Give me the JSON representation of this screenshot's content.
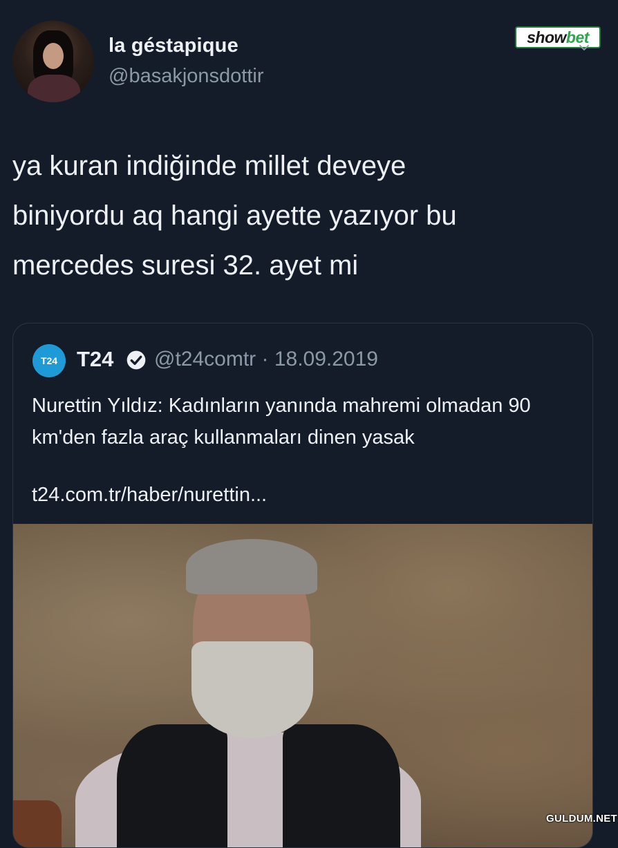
{
  "author": {
    "display_name": "la géstapique",
    "handle": "@basakjonsdottir"
  },
  "badge": {
    "part1": "show",
    "part2": "bet"
  },
  "tweet": {
    "text_line1": "ya kuran indiğinde millet deveye",
    "text_line2": "biniyordu aq hangi ayette yazıyor bu",
    "text_line3": "mercedes suresi 32. ayet mi"
  },
  "quote": {
    "logo_text": "T24",
    "name": "T24",
    "meta": "@t24comtr · 18.09.2019",
    "text": "Nurettin Yıldız: Kadınların yanında mahremi olmadan 90 km'den fazla araç kullanmaları dinen yasak",
    "link": "t24.com.tr/haber/nurettin..."
  },
  "watermark": "GULDUM.NET",
  "colors": {
    "background": "#151c29",
    "text": "#eef1f4",
    "secondary_text": "#8b98a5",
    "brand_blue": "#1e9bd7",
    "badge_green": "#2ea54f"
  },
  "icons": {
    "chevron": "chevron-down-icon",
    "verified": "verified-badge-icon"
  }
}
